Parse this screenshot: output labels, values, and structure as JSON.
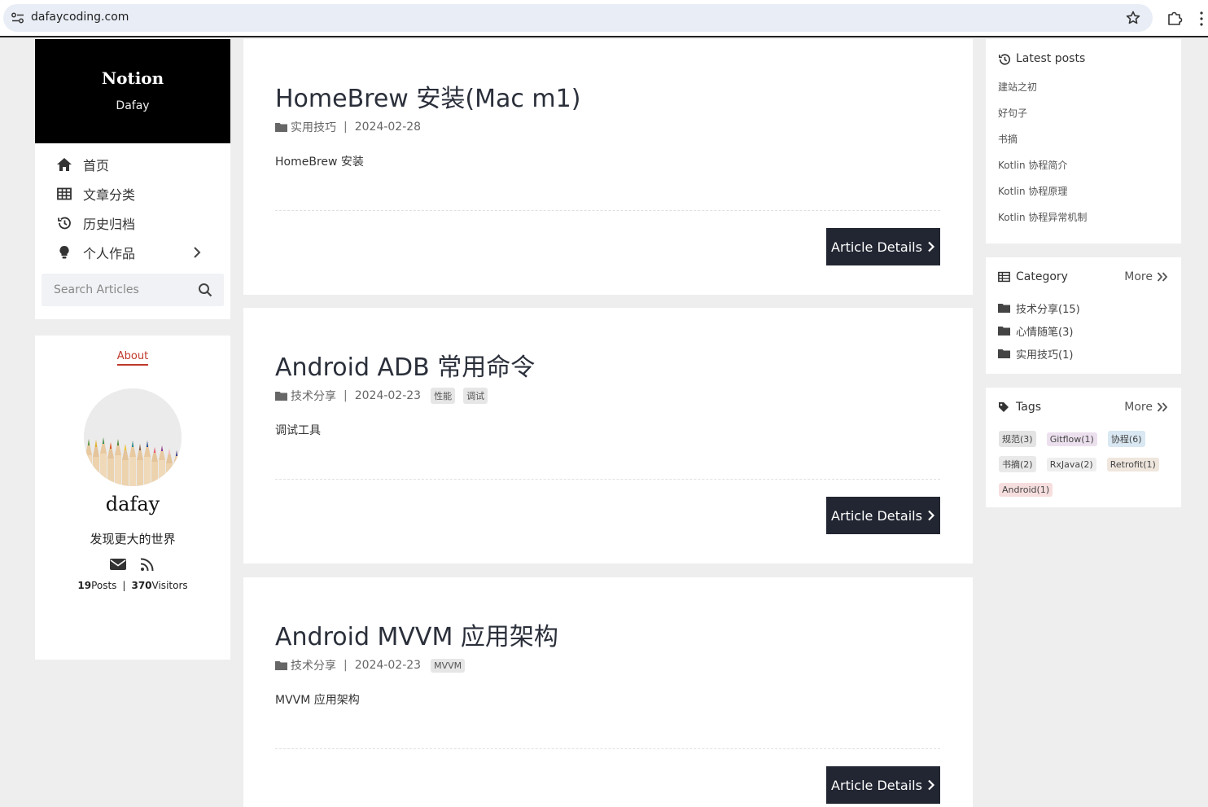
{
  "browser": {
    "url": "dafaycoding.com"
  },
  "sidebar": {
    "brand_title": "Notion",
    "brand_subtitle": "Dafay",
    "nav": [
      {
        "label": "首页",
        "icon": "home-icon"
      },
      {
        "label": "文章分类",
        "icon": "table-icon"
      },
      {
        "label": "历史归档",
        "icon": "history-icon"
      },
      {
        "label": "个人作品",
        "icon": "lightbulb-icon"
      }
    ],
    "search_placeholder": "Search Articles"
  },
  "about": {
    "tab_label": "About",
    "author": "dafay",
    "motto": "发现更大的世界",
    "posts_count": "19",
    "posts_label": "Posts",
    "visitors_count": "370",
    "visitors_label": "Visitors"
  },
  "posts": [
    {
      "title": "HomeBrew 安装(Mac m1)",
      "category": "实用技巧",
      "date": "2024-02-28",
      "tags": [],
      "excerpt": "HomeBrew 安装",
      "button": "Article Details"
    },
    {
      "title": "Android ADB 常用命令",
      "category": "技术分享",
      "date": "2024-02-23",
      "tags": [
        "性能",
        "调试"
      ],
      "excerpt": "调试工具",
      "button": "Article Details"
    },
    {
      "title": "Android MVVM 应用架构",
      "category": "技术分享",
      "date": "2024-02-23",
      "tags": [
        "MVVM"
      ],
      "excerpt": "MVVM 应用架构",
      "button": "Article Details"
    }
  ],
  "latest": {
    "title": "Latest posts",
    "items": [
      "建站之初",
      "好句子",
      "书摘",
      "Kotlin 协程简介",
      "Kotlin 协程原理",
      "Kotlin 协程异常机制"
    ]
  },
  "category": {
    "title": "Category",
    "more": "More",
    "items": [
      "技术分享(15)",
      "心情随笔(3)",
      "实用技巧(1)"
    ]
  },
  "tags": {
    "title": "Tags",
    "more": "More",
    "items": [
      {
        "label": "规范(3)",
        "color": "#e4e4e4"
      },
      {
        "label": "Gitflow(1)",
        "color": "#ece0ee"
      },
      {
        "label": "协程(6)",
        "color": "#d9e8f2"
      },
      {
        "label": "书摘(2)",
        "color": "#e9e9e9"
      },
      {
        "label": "RxJava(2)",
        "color": "#eeeeee"
      },
      {
        "label": "Retrofit(1)",
        "color": "#efe6de"
      },
      {
        "label": "Android(1)",
        "color": "#f7dede"
      }
    ]
  }
}
